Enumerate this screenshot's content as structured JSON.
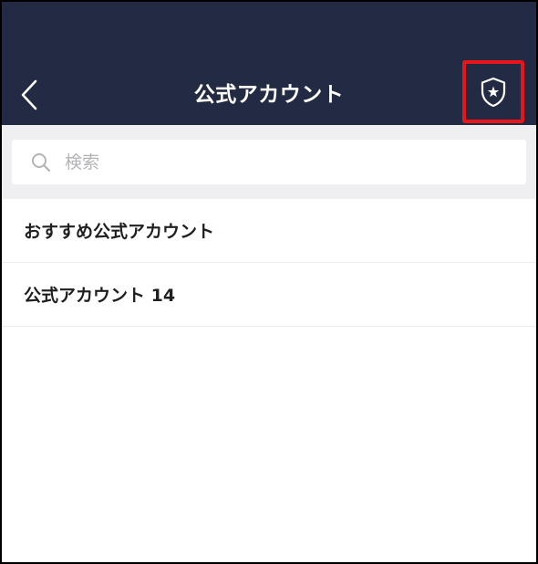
{
  "header": {
    "title": "公式アカウント",
    "back_icon": "chevron-left-icon",
    "official_icon": "shield-star-icon",
    "background_color": "#222a44",
    "highlight_color": "#e8151b"
  },
  "search": {
    "placeholder": "検索",
    "value": "",
    "icon": "search-icon"
  },
  "list": {
    "items": [
      {
        "label": "おすすめ公式アカウント"
      },
      {
        "label": "公式アカウント 14"
      }
    ]
  }
}
